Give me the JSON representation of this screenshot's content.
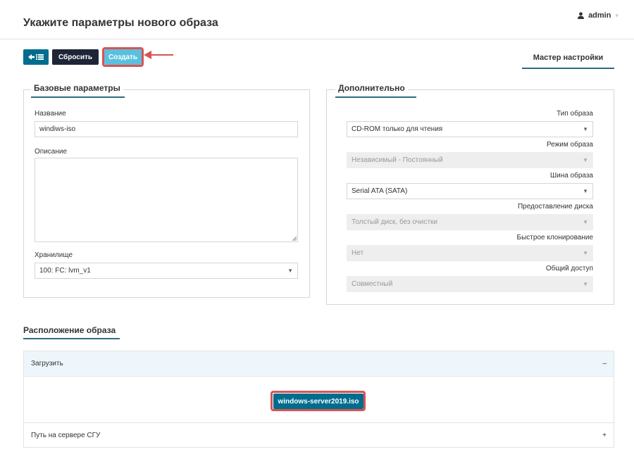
{
  "header": {
    "title": "Укажите параметры нового образа",
    "user": "admin"
  },
  "toolbar": {
    "reset_label": "Сбросить",
    "create_label": "Создать",
    "wizard_tab": "Мастер настройки"
  },
  "basic": {
    "legend": "Базовые параметры",
    "name_label": "Название",
    "name_value": "windiws-iso",
    "description_label": "Описание",
    "description_value": "",
    "storage_label": "Хранилище",
    "storage_value": "100: FC: lvm_v1"
  },
  "extra": {
    "legend": "Дополнительно",
    "fields": [
      {
        "label": "Тип образа",
        "value": "CD-ROM только для чтения",
        "disabled": false
      },
      {
        "label": "Режим образа",
        "value": "Независимый - Постоянный",
        "disabled": true
      },
      {
        "label": "Шина образа",
        "value": "Serial ATA (SATA)",
        "disabled": false
      },
      {
        "label": "Предоставление диска",
        "value": "Толстый диск, без очистки",
        "disabled": true
      },
      {
        "label": "Быстрое клонирование",
        "value": "Нет",
        "disabled": true
      },
      {
        "label": "Общий доступ",
        "value": "Совместный",
        "disabled": true
      }
    ]
  },
  "location": {
    "title": "Расположение образа",
    "upload_label": "Загрузить",
    "upload_toggle": "–",
    "file_name": "windows-server2019.iso",
    "server_path_label": "Путь на сервере СГУ",
    "server_path_toggle": "+"
  },
  "colors": {
    "primary": "#006d8f",
    "dark": "#1d2537",
    "info": "#5bc0de",
    "highlight": "#d9534f"
  }
}
